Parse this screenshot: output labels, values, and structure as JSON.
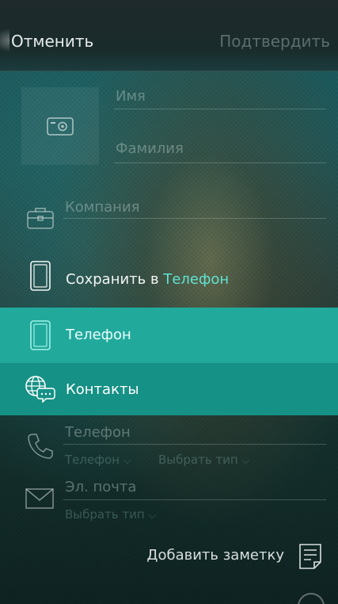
{
  "topbar": {
    "cancel": "Отменить",
    "confirm": "Подтвердить"
  },
  "form": {
    "first_name_placeholder": "Имя",
    "last_name_placeholder": "Фамилия",
    "company_placeholder": "Компания",
    "phone_placeholder": "Телефон",
    "phone_type": "Телефон",
    "phone_choose_type": "Выбрать тип",
    "email_placeholder": "Эл. почта",
    "email_choose_type": "Выбрать тип"
  },
  "save_to": {
    "label": "Сохранить в",
    "value": "Телефон"
  },
  "dropdown": {
    "options": [
      {
        "label": "Телефон",
        "icon": "phone-device-icon",
        "selected": true
      },
      {
        "label": "Контакты",
        "icon": "globe-chat-icon",
        "selected": false
      }
    ]
  },
  "note": {
    "label": "Добавить заметку"
  },
  "icons": [
    "camera-icon",
    "briefcase-icon",
    "phone-device-icon",
    "globe-chat-icon",
    "phone-handset-icon",
    "envelope-icon",
    "note-icon",
    "chevron-down-icon"
  ],
  "colors": {
    "accent": "#5fe3d2",
    "selected_row": "#21a99c",
    "row": "#169185"
  }
}
